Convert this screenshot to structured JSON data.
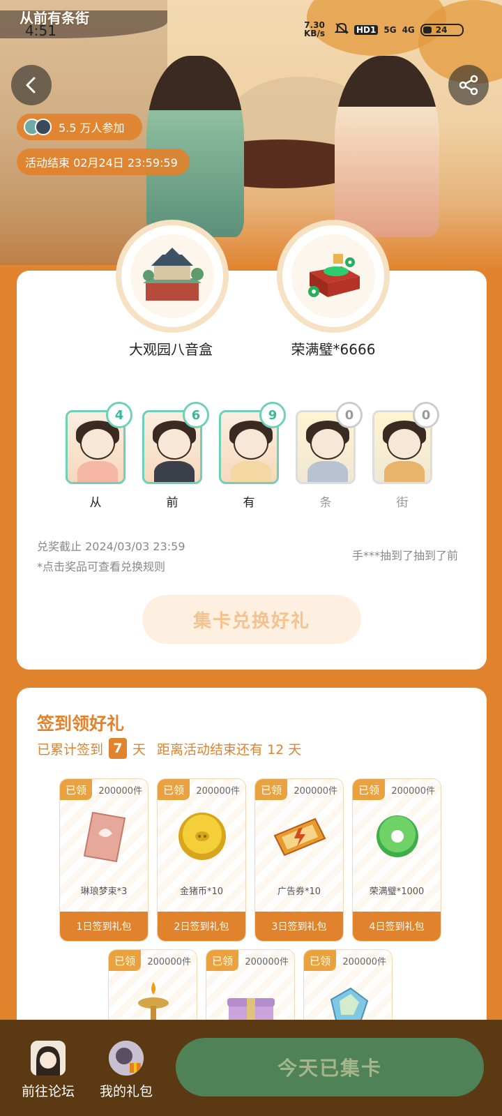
{
  "status_bar": {
    "app_logo": "从前有条街",
    "time": "4:51",
    "net_speed_value": "7.30",
    "net_speed_unit": "KB/s",
    "hd": "HD1",
    "signal_5g": "5G",
    "signal_4g": "4G",
    "battery": "24"
  },
  "event": {
    "participants": "5.5 万人参加",
    "end_time": "活动结束 02月24日 23:59:59"
  },
  "prizes": [
    {
      "name": "大观园八音盒"
    },
    {
      "name": "荣满璧*6666"
    }
  ],
  "cards": [
    {
      "label": "从",
      "count": "4",
      "active": true
    },
    {
      "label": "前",
      "count": "6",
      "active": true
    },
    {
      "label": "有",
      "count": "9",
      "active": true
    },
    {
      "label": "条",
      "count": "0",
      "active": false
    },
    {
      "label": "街",
      "count": "0",
      "active": false
    }
  ],
  "redeem": {
    "deadline": "兑奖截止 2024/03/03 23:59",
    "tip": "*点击奖品可查看兑换规则",
    "ticker": "手***抽到了抽到了前",
    "button": "集卡兑换好礼"
  },
  "signin": {
    "title": "签到领好礼",
    "accum_prefix": "已累计签到",
    "accum_days": "7",
    "accum_suffix": "天",
    "remaining": "距离活动结束还有 12 天",
    "gifts": [
      {
        "claimed": "已领",
        "stock": "200000件",
        "name": "琳琅梦束*3",
        "day": "1日签到礼包",
        "icon": "ticket-icon"
      },
      {
        "claimed": "已领",
        "stock": "200000件",
        "name": "金猪币*10",
        "day": "2日签到礼包",
        "icon": "pig-coin-icon"
      },
      {
        "claimed": "已领",
        "stock": "200000件",
        "name": "广告券*10",
        "day": "3日签到礼包",
        "icon": "ad-coupon-icon"
      },
      {
        "claimed": "已领",
        "stock": "200000件",
        "name": "荣满璧*1000",
        "day": "4日签到礼包",
        "icon": "jade-disc-icon"
      },
      {
        "claimed": "已领",
        "stock": "200000件",
        "name": "",
        "day": "",
        "icon": "oil-lamp-icon"
      },
      {
        "claimed": "已领",
        "stock": "200000件",
        "name": "",
        "day": "",
        "icon": "gift-box-icon"
      },
      {
        "claimed": "已领",
        "stock": "200000件",
        "name": "",
        "day": "",
        "icon": "crystal-icon"
      }
    ]
  },
  "bottom_bar": {
    "forum": "前往论坛",
    "my_gifts": "我的礼包",
    "today_button": "今天已集卡"
  },
  "colors": {
    "accent": "#E1822C",
    "card_border_active": "#6ED0B7",
    "bottom_bar": "#5A3913",
    "today_button": "#4F8256"
  }
}
